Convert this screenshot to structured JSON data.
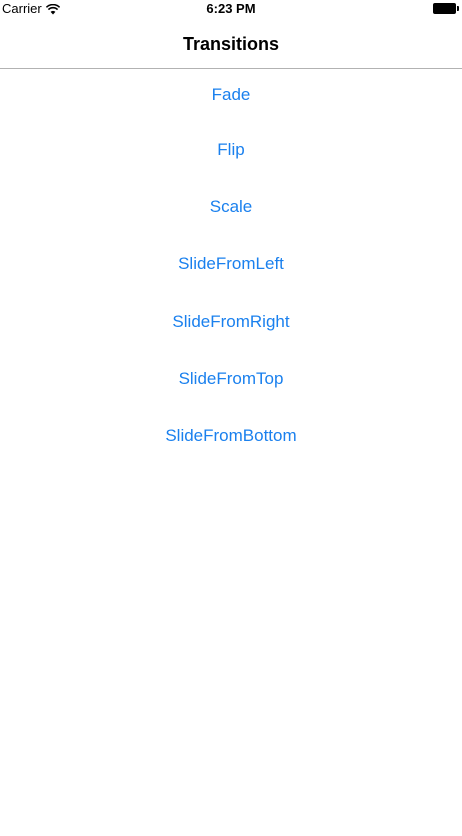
{
  "status_bar": {
    "carrier": "Carrier",
    "time": "6:23 PM",
    "wifi_icon": "wifi-icon",
    "battery_icon": "battery-icon"
  },
  "nav": {
    "title": "Transitions"
  },
  "menu": {
    "items": [
      {
        "label": "Fade"
      },
      {
        "label": "Flip"
      },
      {
        "label": "Scale"
      },
      {
        "label": "SlideFromLeft"
      },
      {
        "label": "SlideFromRight"
      },
      {
        "label": "SlideFromTop"
      },
      {
        "label": "SlideFromBottom"
      }
    ]
  },
  "colors": {
    "link": "#1a80ee",
    "divider": "#b2b2b2",
    "background": "#ffffff"
  }
}
